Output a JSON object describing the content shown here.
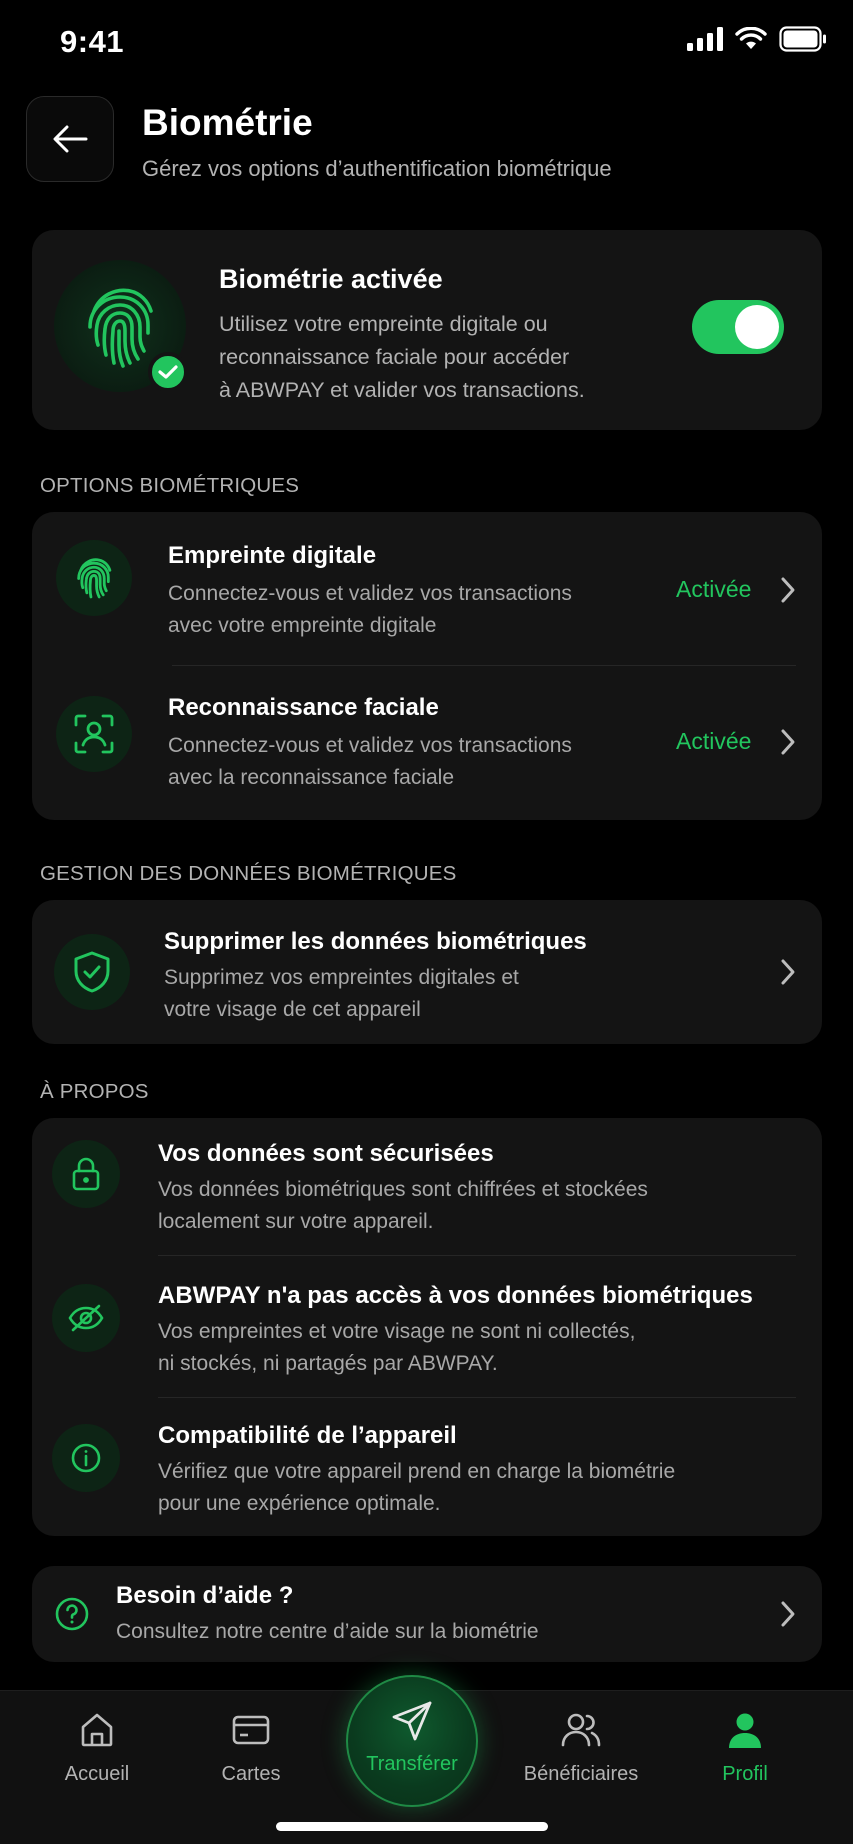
{
  "status_bar": {
    "time": "9:41"
  },
  "header": {
    "title": "Biométrie",
    "subtitle": "Gérez vos options d’authentification biométrique"
  },
  "hero": {
    "title": "Biométrie activée",
    "description_lines": [
      "Utilisez votre empreinte digitale ou",
      "reconnaissance faciale pour accéder",
      "à ABWPAY et valider vos transactions."
    ],
    "enabled": true
  },
  "options_section": {
    "label": "OPTIONS BIOMÉTRIQUES",
    "items": [
      {
        "title": "Empreinte digitale",
        "desc_lines": [
          "Connectez-vous et validez vos transactions",
          "avec votre empreinte digitale"
        ],
        "status": "Activée",
        "icon": "fingerprint-icon"
      },
      {
        "title": "Reconnaissance faciale",
        "desc_lines": [
          "Connectez-vous et validez vos transactions",
          "avec la reconnaissance faciale"
        ],
        "status": "Activée",
        "icon": "face-scan-icon"
      }
    ]
  },
  "data_section": {
    "label": "GESTION DES DONNÉES BIOMÉTRIQUES",
    "item": {
      "title": "Supprimer les données biométriques",
      "desc_lines": [
        "Supprimez vos empreintes digitales et",
        "votre visage de cet appareil"
      ],
      "icon": "shield-check-icon"
    }
  },
  "about_section": {
    "label": "À PROPOS",
    "items": [
      {
        "title": "Vos données sont sécurisées",
        "desc_lines": [
          "Vos données biométriques sont chiffrées et stockées",
          "localement sur votre appareil."
        ],
        "icon": "lock-icon"
      },
      {
        "title": "ABWPAY n'a pas accès à vos données biométriques",
        "desc_lines": [
          "Vos empreintes et votre visage ne sont ni collectés,",
          "ni stockés, ni partagés par ABWPAY."
        ],
        "icon": "eye-off-icon"
      },
      {
        "title": "Compatibilité de l’appareil",
        "desc_lines": [
          "Vérifiez que votre appareil prend en charge la biométrie",
          "pour une expérience optimale."
        ],
        "icon": "info-icon"
      }
    ]
  },
  "help": {
    "title": "Besoin d’aide ?",
    "desc": "Consultez notre centre d’aide sur la biométrie",
    "icon": "help-circle-icon"
  },
  "bottom_nav": {
    "items": [
      {
        "label": "Accueil",
        "icon": "home-icon"
      },
      {
        "label": "Cartes",
        "icon": "card-icon"
      },
      {
        "label": "Transférer",
        "icon": "send-icon"
      },
      {
        "label": "Bénéficiaires",
        "icon": "users-icon"
      },
      {
        "label": "Profil",
        "icon": "profile-icon",
        "active": true
      }
    ]
  },
  "colors": {
    "accent": "#22c55e",
    "background": "#000000",
    "card": "#141414"
  }
}
